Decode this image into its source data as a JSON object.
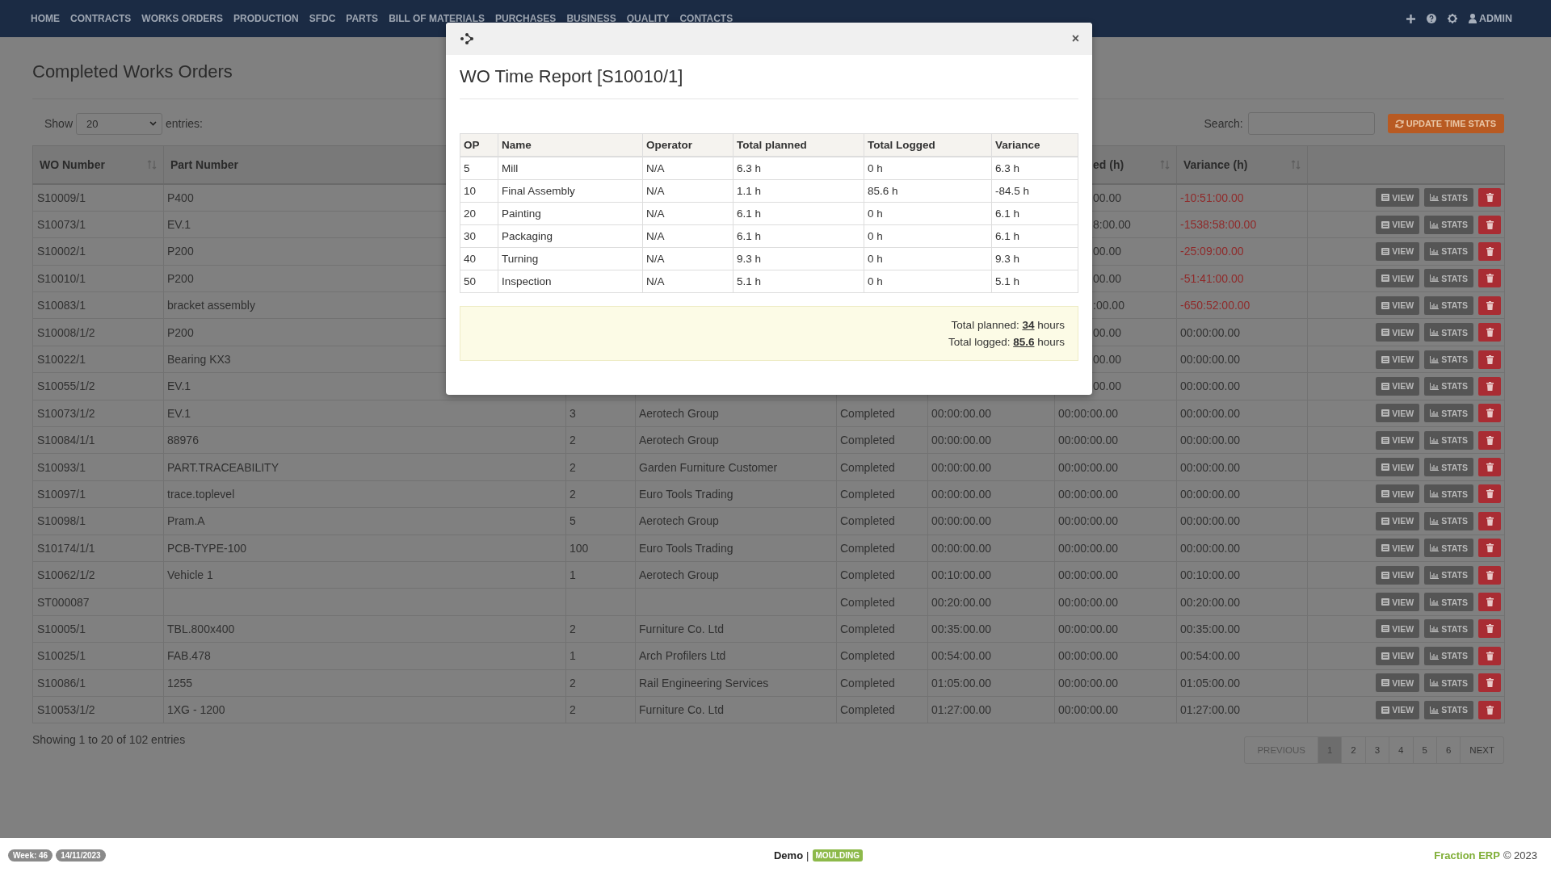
{
  "nav": {
    "items": [
      "HOME",
      "CONTRACTS",
      "WORKS ORDERS",
      "PRODUCTION",
      "SFDC",
      "PARTS",
      "BILL OF MATERIALS",
      "PURCHASES",
      "BUSINESS",
      "QUALITY",
      "CONTACTS"
    ],
    "user": "ADMIN"
  },
  "page": {
    "title": "Completed Works Orders"
  },
  "length_menu": {
    "label_before": "Show",
    "value": "20",
    "label_after": "entries:"
  },
  "search": {
    "label": "Search:"
  },
  "update_button": {
    "label": "UPDATE TIME STATS"
  },
  "table": {
    "columns": [
      {
        "label": "WO Number",
        "sortable": true
      },
      {
        "label": "Part Number"
      },
      {},
      {},
      {},
      {},
      {
        "label": "ed (h)",
        "sortable": true
      },
      {
        "label": "Variance (h)",
        "sortable": true
      },
      {
        "sortable": false
      }
    ],
    "rows": [
      {
        "wo": "S10009/1",
        "part": "P400",
        "column_7": "00.00",
        "variance": "-10:51:00.00",
        "negative": true,
        "actions": [
          "VIEW",
          "STATS"
        ]
      },
      {
        "wo": "S10073/1",
        "part": "EV.1",
        "column_7": "8:00.00",
        "variance": "-1538:58:00.00",
        "negative": true,
        "actions": [
          "VIEW",
          "STATS"
        ]
      },
      {
        "wo": "S10002/1",
        "part": "P200",
        "column_7": "00.00",
        "variance": "-25:09:00.00",
        "negative": true,
        "actions": [
          "VIEW",
          "STATS"
        ]
      },
      {
        "wo": "S10010/1",
        "part": "P200",
        "column_7": "00.00",
        "variance": "-51:41:00.00",
        "negative": true,
        "actions": [
          "VIEW",
          "STATS"
        ]
      },
      {
        "wo": "S10083/1",
        "part": "bracket assembly",
        "column_7": ":00.00",
        "variance": "-650:52:00.00",
        "negative": true,
        "actions": [
          "VIEW",
          "STATS"
        ]
      },
      {
        "wo": "S10008/1/2",
        "part": "P200",
        "column_7": "00.00",
        "variance": "00:00:00.00",
        "negative": false,
        "actions": [
          "VIEW",
          "STATS"
        ]
      },
      {
        "wo": "S10022/1",
        "part": "Bearing KX3",
        "column_7": "00.00",
        "variance": "00:00:00.00",
        "negative": false,
        "actions": [
          "VIEW",
          "STATS"
        ]
      },
      {
        "wo": "S10055/1/2",
        "part": "EV.1",
        "column_7": "00.00",
        "variance": "00:00:00.00",
        "negative": false,
        "actions": [
          "VIEW",
          "STATS"
        ]
      },
      {
        "wo": "S10073/1/2",
        "part": "EV.1",
        "qty": "3",
        "customer": "Aerotech Group",
        "status": "Completed",
        "column_6": "00:00:00.00",
        "column_7": "00:00:00.00",
        "variance": "00:00:00.00",
        "negative": false,
        "actions": [
          "VIEW",
          "STATS"
        ]
      },
      {
        "wo": "S10084/1/1",
        "part": "88976",
        "qty": "2",
        "customer": "Aerotech Group",
        "status": "Completed",
        "column_6": "00:00:00.00",
        "column_7": "00:00:00.00",
        "variance": "00:00:00.00",
        "negative": false,
        "actions": [
          "VIEW",
          "STATS"
        ]
      },
      {
        "wo": "S10093/1",
        "part": "PART.TRACEABILITY",
        "qty": "2",
        "customer": "Garden Furniture Customer",
        "status": "Completed",
        "column_6": "00:00:00.00",
        "column_7": "00:00:00.00",
        "variance": "00:00:00.00",
        "negative": false,
        "actions": [
          "VIEW",
          "STATS"
        ]
      },
      {
        "wo": "S10097/1",
        "part": "trace.toplevel",
        "qty": "2",
        "customer": "Euro Tools Trading",
        "status": "Completed",
        "column_6": "00:00:00.00",
        "column_7": "00:00:00.00",
        "variance": "00:00:00.00",
        "negative": false,
        "actions": [
          "VIEW",
          "STATS"
        ]
      },
      {
        "wo": "S10098/1",
        "part": "Pram.A",
        "qty": "5",
        "customer": "Aerotech Group",
        "status": "Completed",
        "column_6": "00:00:00.00",
        "column_7": "00:00:00.00",
        "variance": "00:00:00.00",
        "negative": false,
        "actions": [
          "VIEW",
          "STATS"
        ]
      },
      {
        "wo": "S10174/1/1",
        "part": "PCB-TYPE-100",
        "qty": "100",
        "customer": "Euro Tools Trading",
        "status": "Completed",
        "column_6": "00:00:00.00",
        "column_7": "00:00:00.00",
        "variance": "00:00:00.00",
        "negative": false,
        "actions": [
          "VIEW",
          "STATS"
        ]
      },
      {
        "wo": "S10062/1/2",
        "part": "Vehicle 1",
        "qty": "1",
        "customer": "Aerotech Group",
        "status": "Completed",
        "column_6": "00:10:00.00",
        "column_7": "00:00:00.00",
        "variance": "00:10:00.00",
        "negative": false,
        "actions": [
          "VIEW",
          "STATS"
        ]
      },
      {
        "wo": "ST000087",
        "status": "Completed",
        "column_6": "00:20:00.00",
        "column_7": "00:00:00.00",
        "variance": "00:20:00.00",
        "negative": false,
        "actions": [
          "VIEW",
          "STATS"
        ]
      },
      {
        "wo": "S10005/1",
        "part": "TBL.800x400",
        "qty": "2",
        "customer": "Furniture Co. Ltd",
        "status": "Completed",
        "column_6": "00:35:00.00",
        "column_7": "00:00:00.00",
        "variance": "00:35:00.00",
        "negative": false,
        "actions": [
          "VIEW",
          "STATS"
        ]
      },
      {
        "wo": "S10025/1",
        "part": "FAB.478",
        "qty": "1",
        "customer": "Arch Profilers Ltd",
        "status": "Completed",
        "column_6": "00:54:00.00",
        "column_7": "00:00:00.00",
        "variance": "00:54:00.00",
        "negative": false,
        "actions": [
          "VIEW",
          "STATS"
        ]
      },
      {
        "wo": "S10086/1",
        "part": "1255",
        "qty": "2",
        "customer": "Rail Engineering Services",
        "status": "Completed",
        "column_6": "01:05:00.00",
        "column_7": "00:00:00.00",
        "variance": "01:05:00.00",
        "negative": false,
        "actions": [
          "VIEW",
          "STATS"
        ]
      },
      {
        "wo": "S10053/1/2",
        "part": "1XG - 1200",
        "qty": "2",
        "customer": "Furniture Co. Ltd",
        "status": "Completed",
        "column_6": "01:27:00.00",
        "column_7": "00:00:00.00",
        "variance": "01:27:00.00",
        "negative": false,
        "actions": [
          "VIEW",
          "STATS"
        ]
      }
    ]
  },
  "info": "Showing 1 to 20 of 102 entries",
  "pagination": [
    {
      "label": "PREVIOUS",
      "selected": false,
      "disabled": true
    },
    {
      "label": "1",
      "selected": true,
      "disabled": false
    },
    {
      "label": "2",
      "selected": false,
      "disabled": false
    },
    {
      "label": "3",
      "selected": false,
      "disabled": false
    },
    {
      "label": "4",
      "selected": false,
      "disabled": false
    },
    {
      "label": "5",
      "selected": false,
      "disabled": false
    },
    {
      "label": "6",
      "selected": false,
      "disabled": false
    },
    {
      "label": "NEXT",
      "selected": false,
      "disabled": false
    }
  ],
  "modal": {
    "close": "×",
    "title": "WO Time Report [S10010/1]",
    "columns": [
      "OP",
      "Name",
      "Operator",
      "Total planned",
      "Total Logged",
      "Variance"
    ],
    "rows": [
      [
        "5",
        "Mill",
        "N/A",
        "6.3 h",
        "0 h",
        "6.3 h"
      ],
      [
        "10",
        "Final Assembly",
        "N/A",
        "1.1 h",
        "85.6 h",
        "-84.5 h"
      ],
      [
        "20",
        "Painting",
        "N/A",
        "6.1 h",
        "0 h",
        "6.1 h"
      ],
      [
        "30",
        "Packaging",
        "N/A",
        "6.1 h",
        "0 h",
        "6.1 h"
      ],
      [
        "40",
        "Turning",
        "N/A",
        "9.3 h",
        "0 h",
        "9.3 h"
      ],
      [
        "50",
        "Inspection",
        "N/A",
        "5.1 h",
        "0 h",
        "5.1 h"
      ]
    ],
    "summary": [
      "Total planned: **34** hours",
      "Total logged: **85.6** hours"
    ]
  },
  "footer": {
    "badges": [
      "Week: 46",
      "14/11/2023"
    ],
    "company": "Demo",
    "separator": "|",
    "mode": "MOULDING",
    "brand": "Fraction ERP",
    "copyright": "© 2023"
  }
}
